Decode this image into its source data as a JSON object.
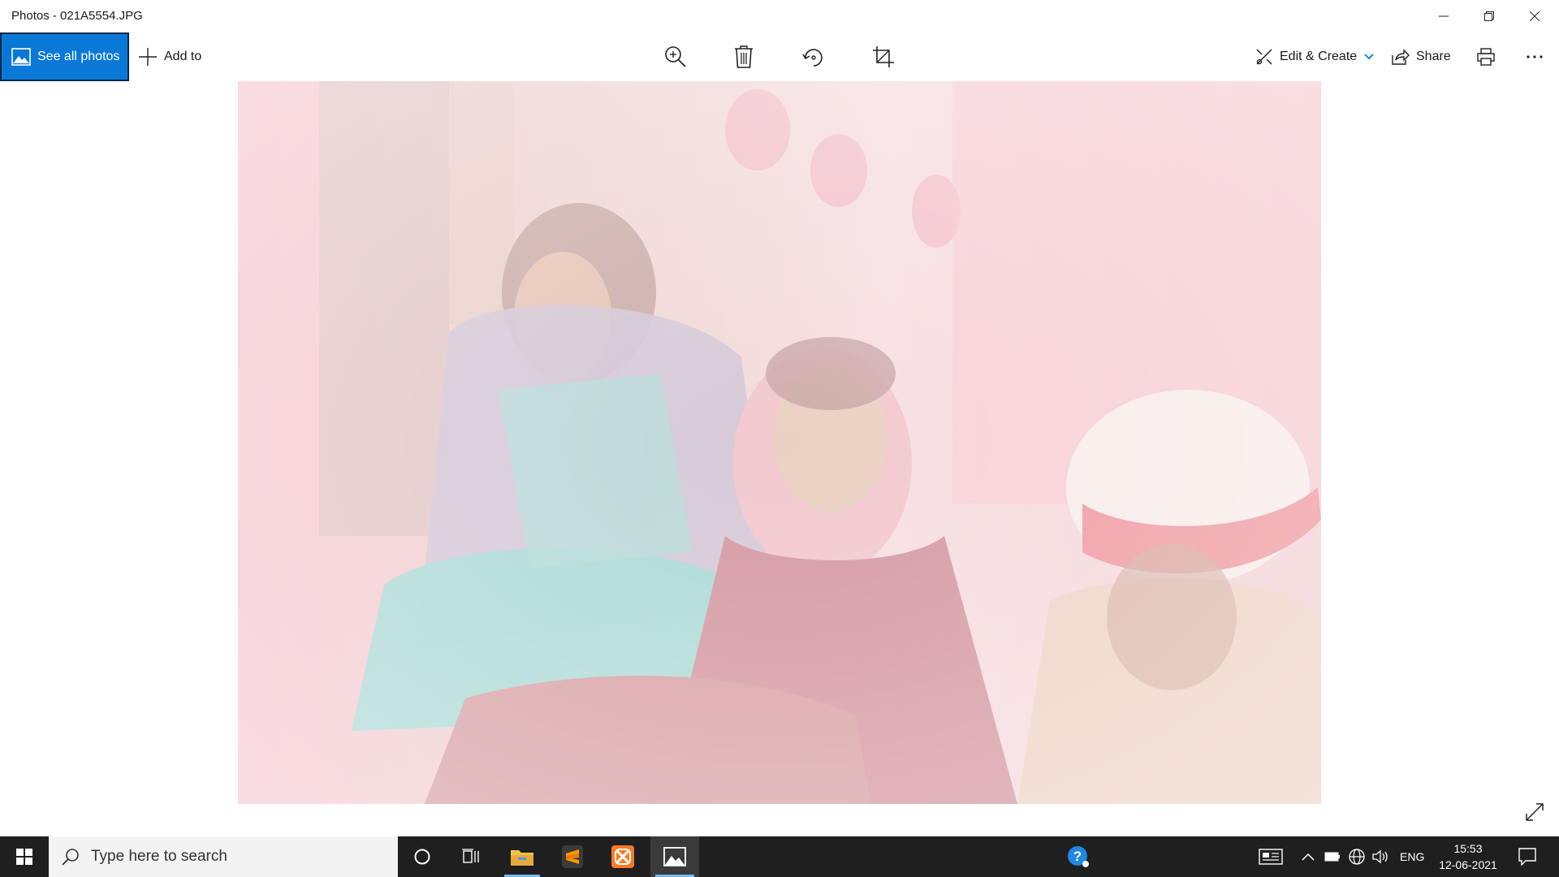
{
  "window": {
    "title": "Photos - 021A5554.JPG"
  },
  "toolbar": {
    "see_all_label": "See all photos",
    "add_to_label": "Add to",
    "edit_create_label": "Edit & Create",
    "share_label": "Share"
  },
  "taskbar": {
    "search_placeholder": "Type here to search",
    "language": "ENG",
    "time": "15:53",
    "date": "12-06-2021"
  },
  "colors": {
    "accent": "#0a78d7",
    "taskbar": "#1f1f1f"
  },
  "icons": {
    "toolbar": [
      "zoom-in-icon",
      "delete-icon",
      "rotate-icon",
      "crop-icon",
      "print-icon",
      "more-icon"
    ],
    "taskbar": [
      "windows-start-icon",
      "cortana-icon",
      "task-view-icon",
      "file-explorer-icon",
      "sublime-text-icon",
      "xampp-icon",
      "photos-app-icon",
      "help-icon"
    ]
  }
}
